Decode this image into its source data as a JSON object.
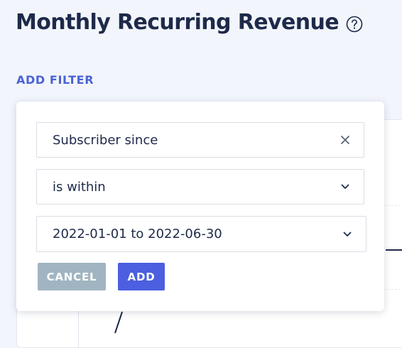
{
  "header": {
    "title": "Monthly Recurring Revenue",
    "help_icon": "question-circle-icon"
  },
  "toolbar": {
    "add_filter_label": "ADD FILTER"
  },
  "filter_popover": {
    "field": {
      "value": "Subscriber since",
      "icon": "close-icon"
    },
    "operator": {
      "value": "is within",
      "icon": "chevron-down-icon"
    },
    "date_range": {
      "value": "2022-01-01 to 2022-06-30",
      "icon": "chevron-down-icon"
    },
    "cancel_label": "CANCEL",
    "add_label": "ADD"
  },
  "colors": {
    "accent": "#4b5fe0",
    "link": "#4b63d6",
    "cancel_disabled": "#a0b5c1",
    "title": "#1e2a4a",
    "background": "#f2f5fb"
  }
}
